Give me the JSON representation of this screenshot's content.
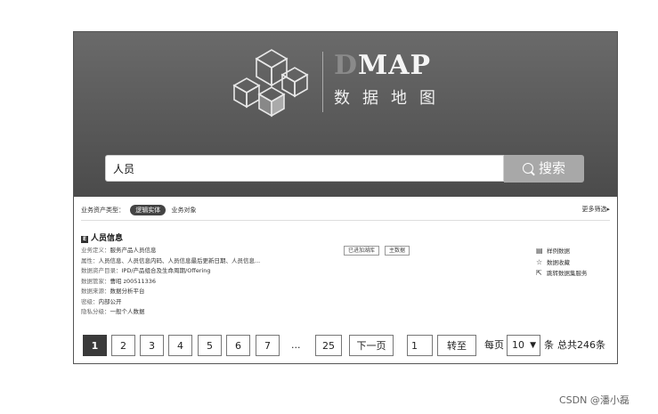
{
  "brand": {
    "name_dim": "D",
    "name": "MAP",
    "sub": "数据地图"
  },
  "search": {
    "value": "人员",
    "button_label": "搜索",
    "icon": "search-icon"
  },
  "filters": {
    "label": "业务资产类型：",
    "items": [
      {
        "label": "逻辑实体",
        "active": true
      },
      {
        "label": "业务对象",
        "active": false
      }
    ],
    "more": "更多筛选▸"
  },
  "result": {
    "title": "人员信息",
    "title_icon": "entity-icon",
    "fields": [
      {
        "key": "业务定义：",
        "value": "服务产品人员信息"
      },
      {
        "key": "属性：",
        "value": "人员信息、人员信息内码、人员信息最后更新日期、人员信息..."
      },
      {
        "key": "数据资产目录：",
        "value": "IPD/产品组合及生命周期/Offering"
      },
      {
        "key": "数据管家：",
        "value": "曹昭 z00511336"
      },
      {
        "key": "数据来源：",
        "value": "数据分析平台"
      },
      {
        "key": "密级：",
        "value": "内部公开"
      },
      {
        "key": "隐私分级：",
        "value": "一般个人数据"
      }
    ],
    "tags": [
      "已进加湖库",
      "主数据"
    ],
    "actions": [
      {
        "icon": "sample-data-icon",
        "label": "样例数据"
      },
      {
        "icon": "star-icon",
        "label": "数据收藏"
      },
      {
        "icon": "jump-icon",
        "label": "跳转数据集服务"
      }
    ]
  },
  "pagination": {
    "pages": [
      "1",
      "2",
      "3",
      "4",
      "5",
      "6",
      "7"
    ],
    "ellipsis": "...",
    "last_page": "25",
    "next_label": "下一页",
    "goto_value": "1",
    "goto_label": "转至",
    "per_page_label": "每页",
    "per_page_value": "10",
    "unit_label": "条",
    "total_label": "总共246条"
  },
  "watermark": "CSDN @潘小磊"
}
